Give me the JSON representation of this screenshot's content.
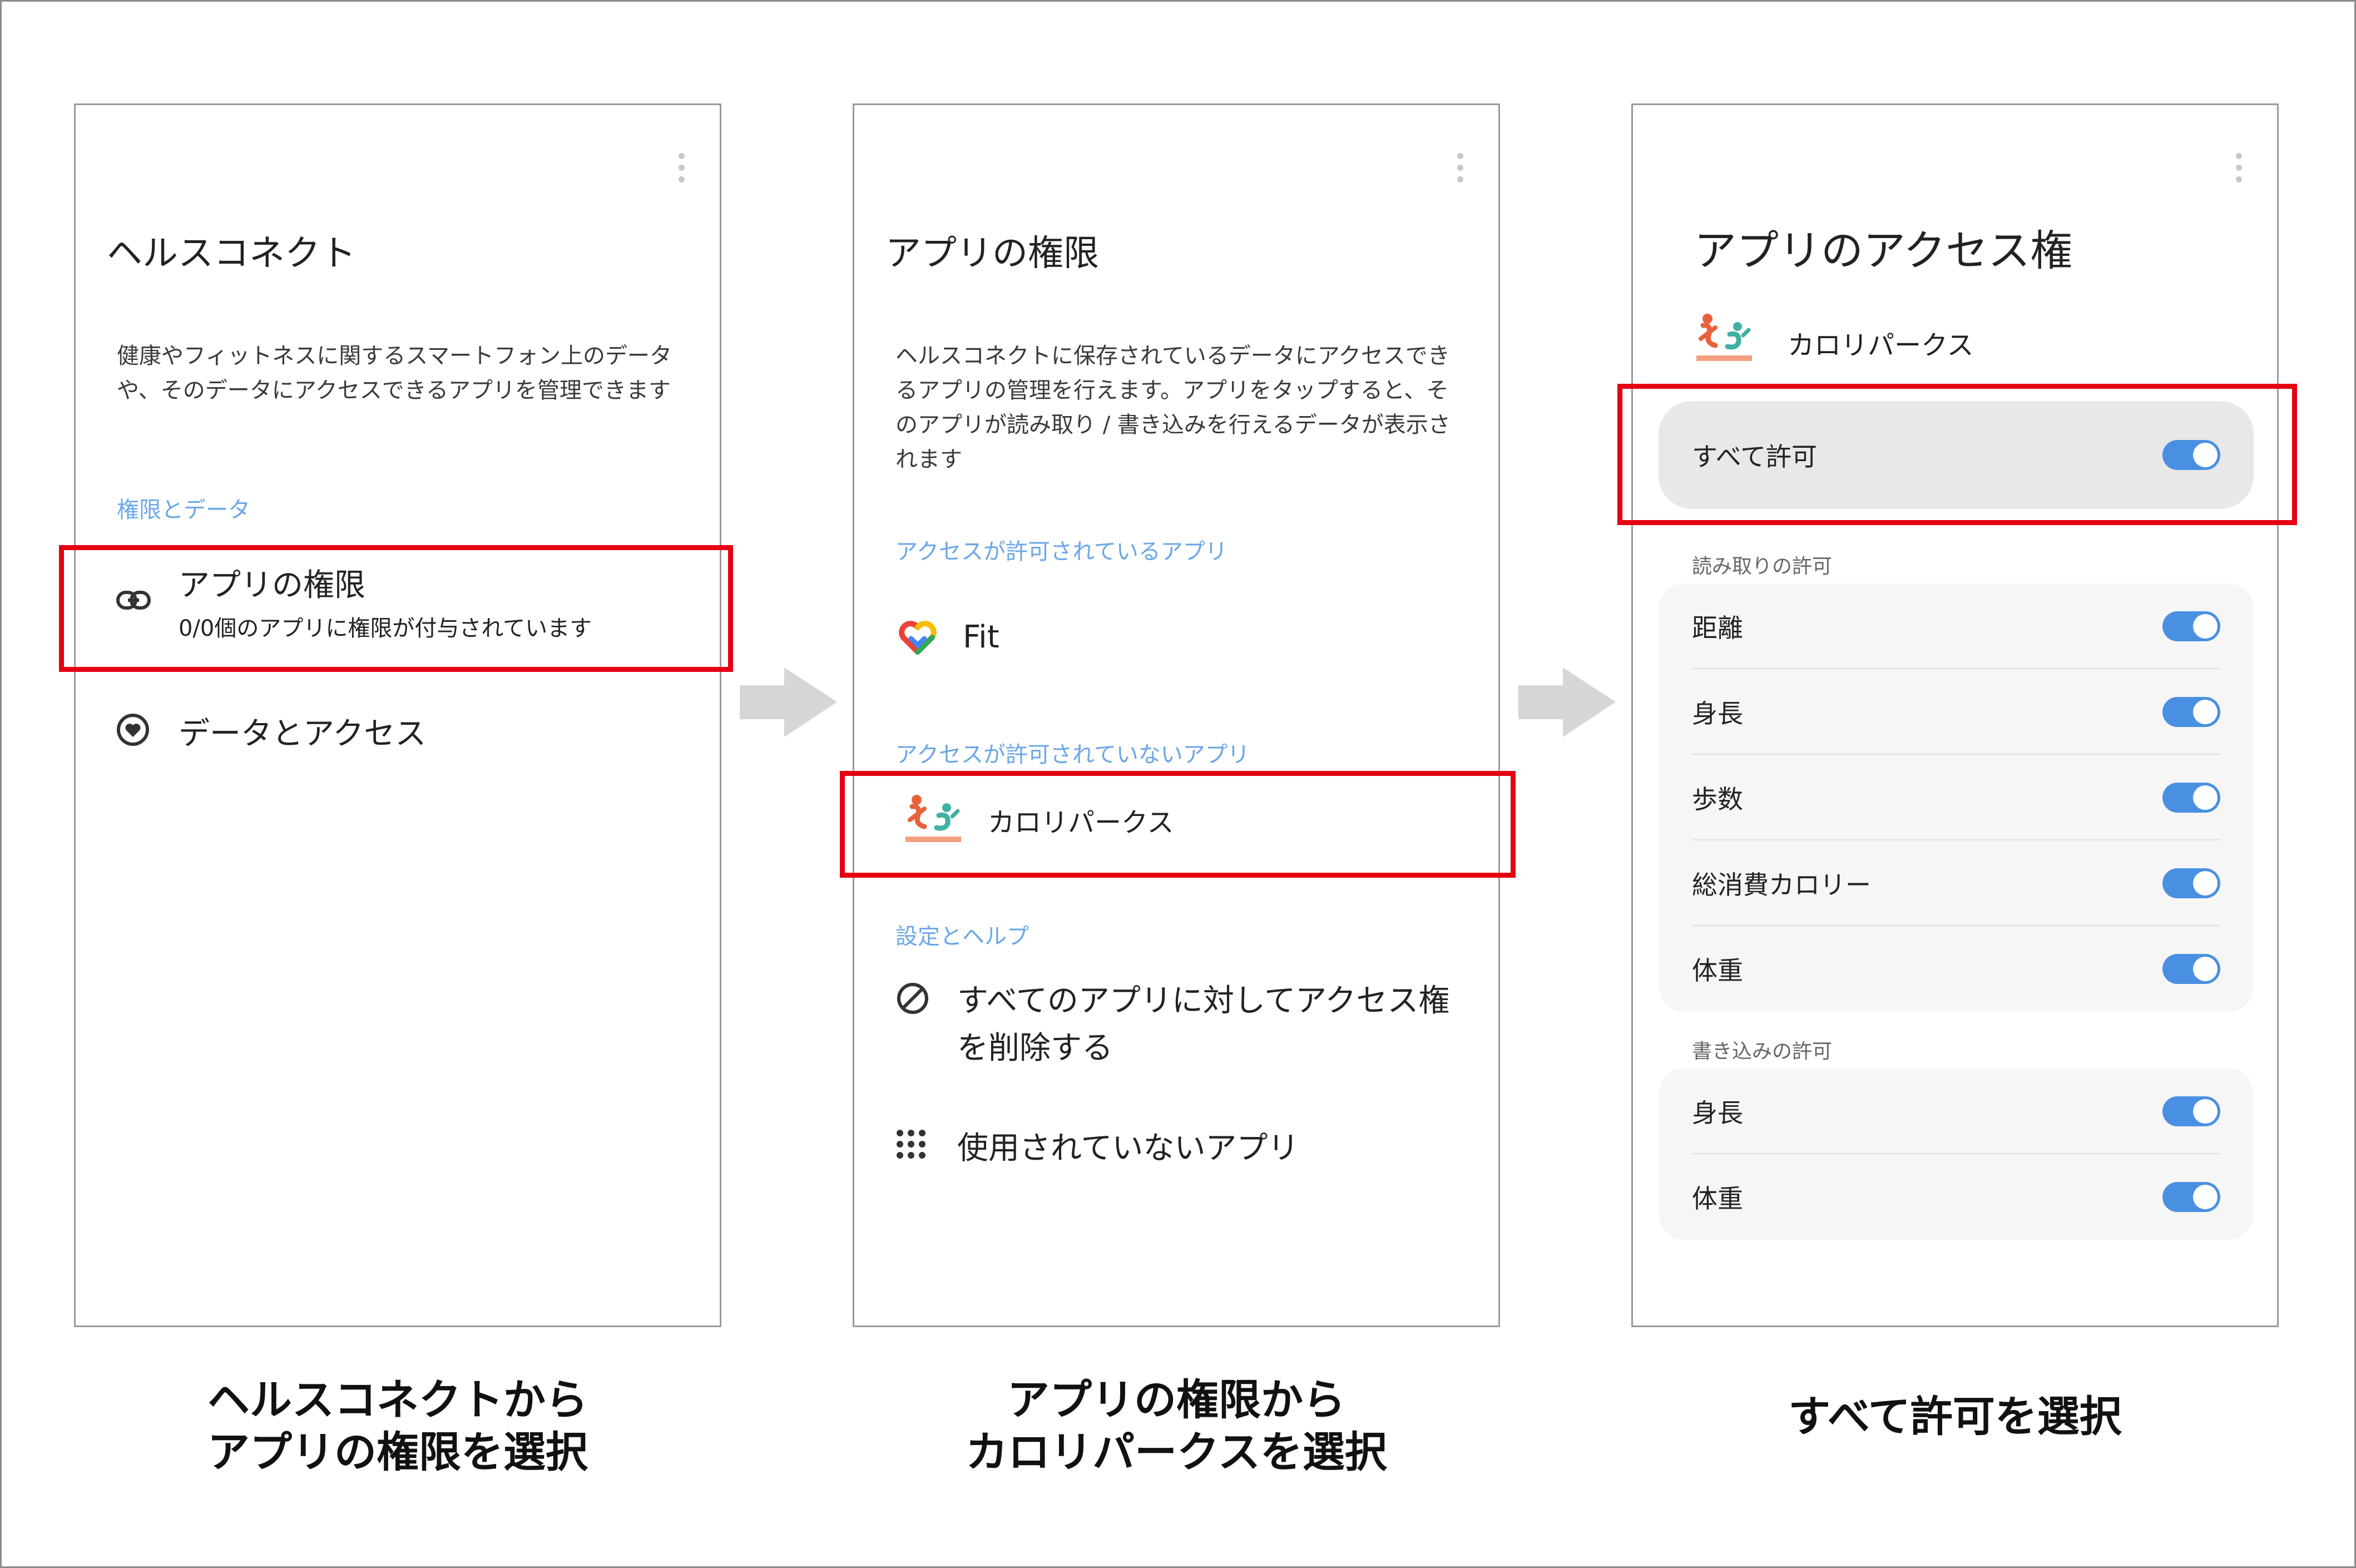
{
  "screen1": {
    "title": "ヘルスコネクト",
    "description": "健康やフィットネスに関するスマートフォン上のデータや、そのデータにアクセスできるアプリを管理できます",
    "section_label": "権限とデータ",
    "app_permissions_label": "アプリの権限",
    "app_permissions_sub": "0/0個のアプリに権限が付与されています",
    "data_access_label": "データとアクセス",
    "icons": [
      "link-icon",
      "heart-circle-icon"
    ]
  },
  "screen2": {
    "title": "アプリの権限",
    "description": "ヘルスコネクトに保存されているデータにアクセスできるアプリの管理を行えます。アプリをタップすると、そのアプリが読み取り / 書き込みを行えるデータが表示されます",
    "allowed_section": "アクセスが許可されているアプリ",
    "fit_label": "Fit",
    "not_allowed_section": "アクセスが許可されていないアプリ",
    "kp_label": "カロリパークス",
    "settings_section": "設定とヘルプ",
    "remove_all_label_line1": "すべてのアプリに対してアクセス権",
    "remove_all_label_line2": "を削除する",
    "unused_apps_label": "使用されていないアプリ",
    "icons": [
      "fit-heart-icon",
      "kp-logo-icon",
      "block-icon",
      "grid-icon"
    ]
  },
  "screen3": {
    "title": "アプリのアクセス権",
    "app_name": "カロリパークス",
    "allow_all_label": "すべて許可",
    "allow_all_on": true,
    "read_section": "読み取りの許可",
    "read_items": [
      {
        "label": "距離",
        "on": true
      },
      {
        "label": "身長",
        "on": true
      },
      {
        "label": "歩数",
        "on": true
      },
      {
        "label": "総消費カロリー",
        "on": true
      },
      {
        "label": "体重",
        "on": true
      }
    ],
    "write_section": "書き込みの許可",
    "write_items": [
      {
        "label": "身長",
        "on": true
      },
      {
        "label": "体重",
        "on": true
      }
    ]
  },
  "captions": {
    "caption1_line1": "ヘルスコネクトから",
    "caption1_line2": "アプリの権限を選択",
    "caption2_line1": "アプリの権限から",
    "caption2_line2": "カロリパークスを選択",
    "caption3": "すべて許可を選択"
  },
  "colors": {
    "highlight": "#e50012",
    "section_blue": "#6ba7e8",
    "toggle_on": "#4a90e2",
    "arrow_gray": "#d6d6d6"
  }
}
